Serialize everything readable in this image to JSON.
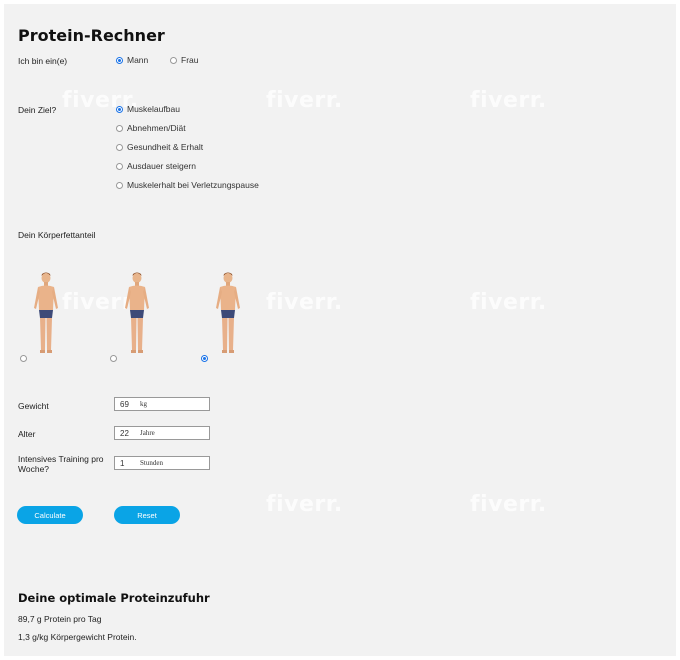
{
  "title": "Protein-Rechner",
  "gender": {
    "label": "Ich bin ein(e)",
    "options": [
      {
        "label": "Mann",
        "checked": true
      },
      {
        "label": "Frau",
        "checked": false
      }
    ]
  },
  "goal": {
    "label": "Dein Ziel?",
    "options": [
      {
        "label": "Muskelaufbau",
        "checked": true
      },
      {
        "label": "Abnehmen/Diät",
        "checked": false
      },
      {
        "label": "Gesundheit & Erhalt",
        "checked": false
      },
      {
        "label": "Ausdauer steigern",
        "checked": false
      },
      {
        "label": "Muskelerhalt bei Verletzungspause",
        "checked": false
      }
    ]
  },
  "bodyfat": {
    "label": "Dein Körperfettanteil",
    "selected_index": 2
  },
  "fields": {
    "weight": {
      "label": "Gewicht",
      "value": "69",
      "unit": "kg"
    },
    "age": {
      "label": "Alter",
      "value": "22",
      "unit": "Jahre"
    },
    "training": {
      "label": "Intensives Training pro Woche?",
      "value": "1",
      "unit": "Stunden"
    }
  },
  "buttons": {
    "calculate": "Calculate",
    "reset": "Reset"
  },
  "result": {
    "title": "Deine optimale Proteinzufuhr",
    "per_day": "89,7 g Protein pro Tag",
    "per_kg": "1,3 g/kg Körpergewicht Protein."
  },
  "watermark": "fiverr.",
  "colors": {
    "accent": "#0aa4e6",
    "radio": "#1a73e8"
  }
}
